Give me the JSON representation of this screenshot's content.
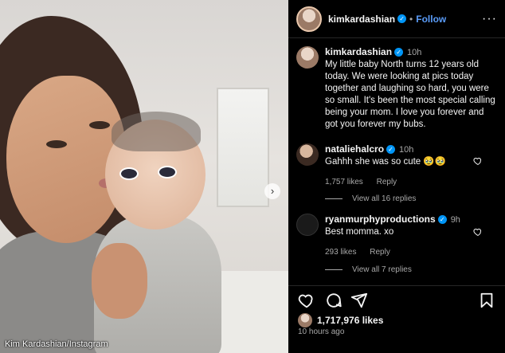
{
  "photo": {
    "credit": "Kim Kardashian/Instagram",
    "next_glyph": "›"
  },
  "header": {
    "username": "kimkardashian",
    "separator": "•",
    "follow_label": "Follow",
    "more_glyph": "···",
    "verified_glyph": "✓"
  },
  "caption": {
    "username": "kimkardashian",
    "time": "10h",
    "text": "My little baby North turns 12 years old today. We were looking at pics today together and laughing so hard, you were so small. It's been the most special calling being your mom. I love you forever and got you forever my bubs."
  },
  "comments": [
    {
      "username": "nataliehalcro",
      "time": "10h",
      "text": "Gahhh she was so cute 🥹🥹",
      "likes": "1,757 likes",
      "reply_label": "Reply",
      "view_replies": "View all 16 replies"
    },
    {
      "username": "ryanmurphyproductions",
      "time": "9h",
      "text": "Best momma. xo",
      "likes": "293 likes",
      "reply_label": "Reply",
      "view_replies": "View all 7 replies"
    }
  ],
  "post": {
    "likes": "1,717,976 likes",
    "time_ago": "10 hours ago"
  },
  "icons": [
    "heart-icon",
    "comment-icon",
    "share-icon",
    "bookmark-icon",
    "more-icon",
    "verified-icon",
    "chevron-right-icon"
  ],
  "colors": {
    "background": "#000000",
    "accent": "#0095f6",
    "follow": "#5a9cf8",
    "muted_text": "#a8a8a8"
  }
}
